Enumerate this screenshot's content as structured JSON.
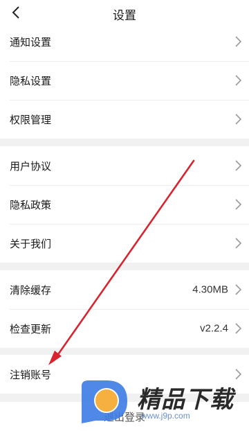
{
  "header": {
    "title": "设置",
    "back_icon": "chevron-left-icon"
  },
  "groups": [
    {
      "items": [
        {
          "label": "通知设置",
          "value": ""
        },
        {
          "label": "隐私设置",
          "value": ""
        },
        {
          "label": "权限管理",
          "value": ""
        }
      ]
    },
    {
      "items": [
        {
          "label": "用户协议",
          "value": ""
        },
        {
          "label": "隐私政策",
          "value": ""
        },
        {
          "label": "关于我们",
          "value": ""
        }
      ]
    },
    {
      "items": [
        {
          "label": "清除缓存",
          "value": "4.30MB"
        },
        {
          "label": "检查更新",
          "value": "v2.2.4"
        }
      ]
    },
    {
      "items": [
        {
          "label": "注销账号",
          "value": ""
        }
      ]
    }
  ],
  "logout": {
    "label": "退出登录"
  },
  "watermark": {
    "brand": "精品下载",
    "url": "www.j9p.com"
  },
  "colors": {
    "annotation_arrow": "#d9232e",
    "watermark_blue": "#3d7be6",
    "watermark_orange": "#f5b040"
  }
}
